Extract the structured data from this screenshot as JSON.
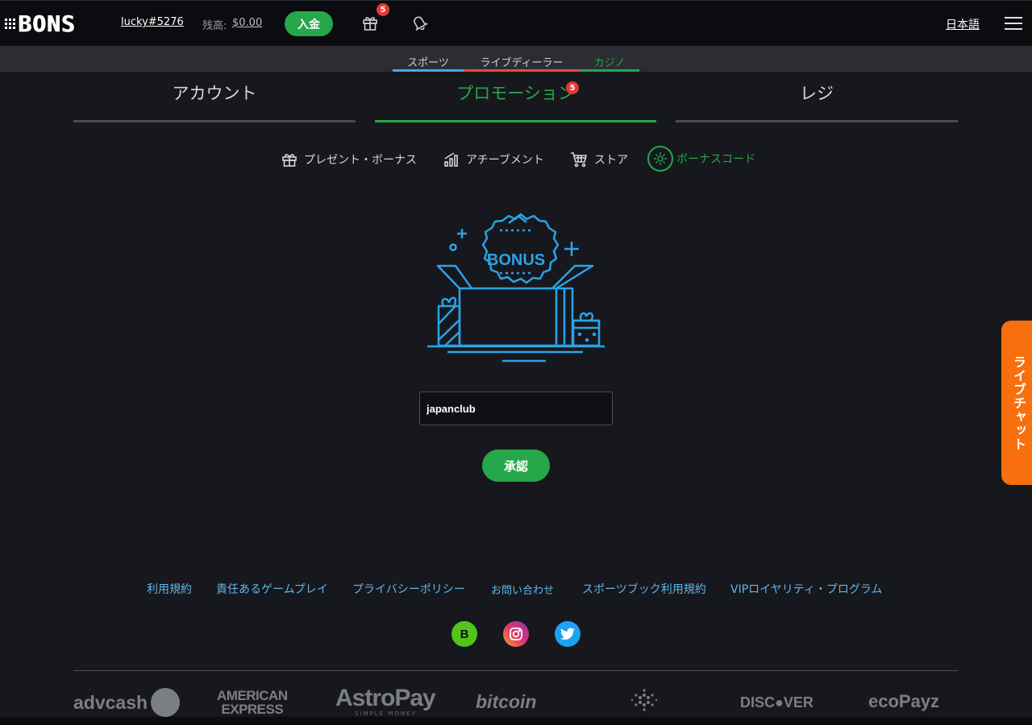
{
  "header": {
    "logo_text": "BONS",
    "username": "lucky#5276",
    "balance_label": "残高:",
    "balance_value": "$0.00",
    "deposit_label": "入金",
    "gift_badge_count": "5",
    "language": "日本語"
  },
  "category_nav": {
    "items": [
      {
        "label": "スポーツ",
        "color": "#46a9e8"
      },
      {
        "label": "ライブディーラー",
        "color": "#e8493d"
      },
      {
        "label": "カジノ",
        "color": "#25a74a",
        "active": true
      }
    ]
  },
  "main_tabs": [
    {
      "label": "アカウント"
    },
    {
      "label": "プロモーション",
      "active": true,
      "badge": "5"
    },
    {
      "label": "レジ"
    }
  ],
  "sub_tabs": [
    {
      "label": "プレゼント・ボーナス",
      "icon": "gift-icon"
    },
    {
      "label": "アチーブメント",
      "icon": "bar-chart-icon"
    },
    {
      "label": "ストア",
      "icon": "cart-icon"
    },
    {
      "label": "ボーナスコード",
      "icon": "bonus-code-icon",
      "active": true
    }
  ],
  "bonus_illustration": {
    "text": "BONUS"
  },
  "bonus_form": {
    "code_value": "japanclub",
    "submit_label": "承認"
  },
  "live_chat": {
    "label": "ライブチャット"
  },
  "footer": {
    "links": [
      "利用規約",
      "責任あるゲームプレイ",
      "プライバシーポリシー",
      "お問い合わせ",
      "スポーツブック利用規約",
      "VIPロイヤリティ・プログラム"
    ],
    "social": [
      "bons-icon",
      "instagram-icon",
      "twitter-icon"
    ],
    "payments": {
      "advcash": "advcash",
      "amex_line1": "AMERICAN",
      "amex_line2": "EXPRESS",
      "astropay": "AstroPay",
      "astropay_sub": "SIMPLE MONEY",
      "bitcoin": "bitcoin",
      "discover": "DISC●VER",
      "ecopayz": "ecoPayz"
    }
  },
  "colors": {
    "accent_green": "#25a74a",
    "link_blue": "#5fb6ec",
    "live_chat_orange": "#f7700d",
    "illustration_blue": "#2aa3e8"
  }
}
